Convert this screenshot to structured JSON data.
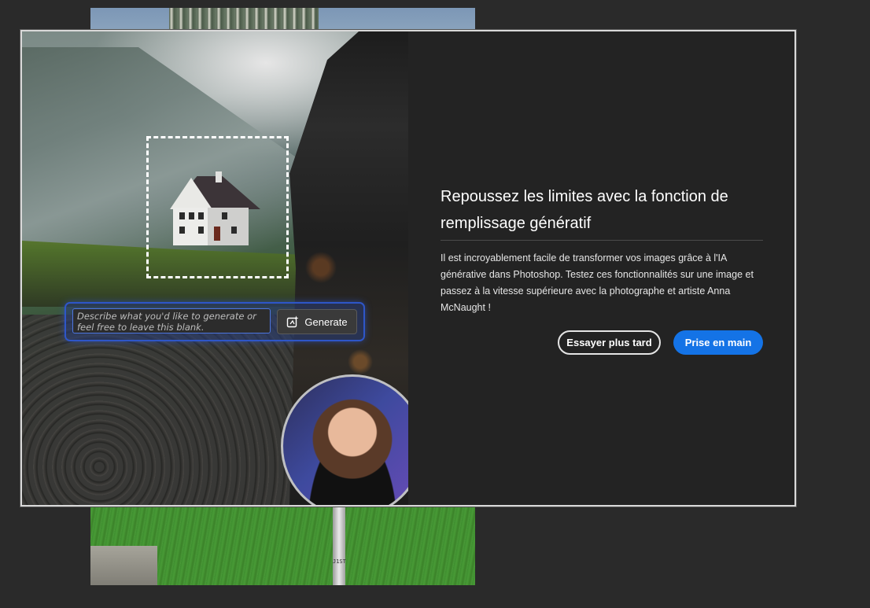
{
  "background_document": {
    "pole_label": "J1ST"
  },
  "modal": {
    "title": "Repoussez les limites avec la fonction de remplissage génératif",
    "description": "Il est incroyablement facile de transformer vos images grâce à l'IA générative dans Photoshop. Testez ces fonctionnalités sur une image et passez à la vitesse supérieure avec la photographe et artiste Anna McNaught !",
    "secondary_button": "Essayer plus tard",
    "primary_button": "Prise en main",
    "accent_color": "#1473e6"
  },
  "hero": {
    "prompt_placeholder": "Describe what you'd like to generate or feel free to leave this blank.",
    "generate_label": "Generate",
    "generate_icon": "generative-fill-icon"
  }
}
